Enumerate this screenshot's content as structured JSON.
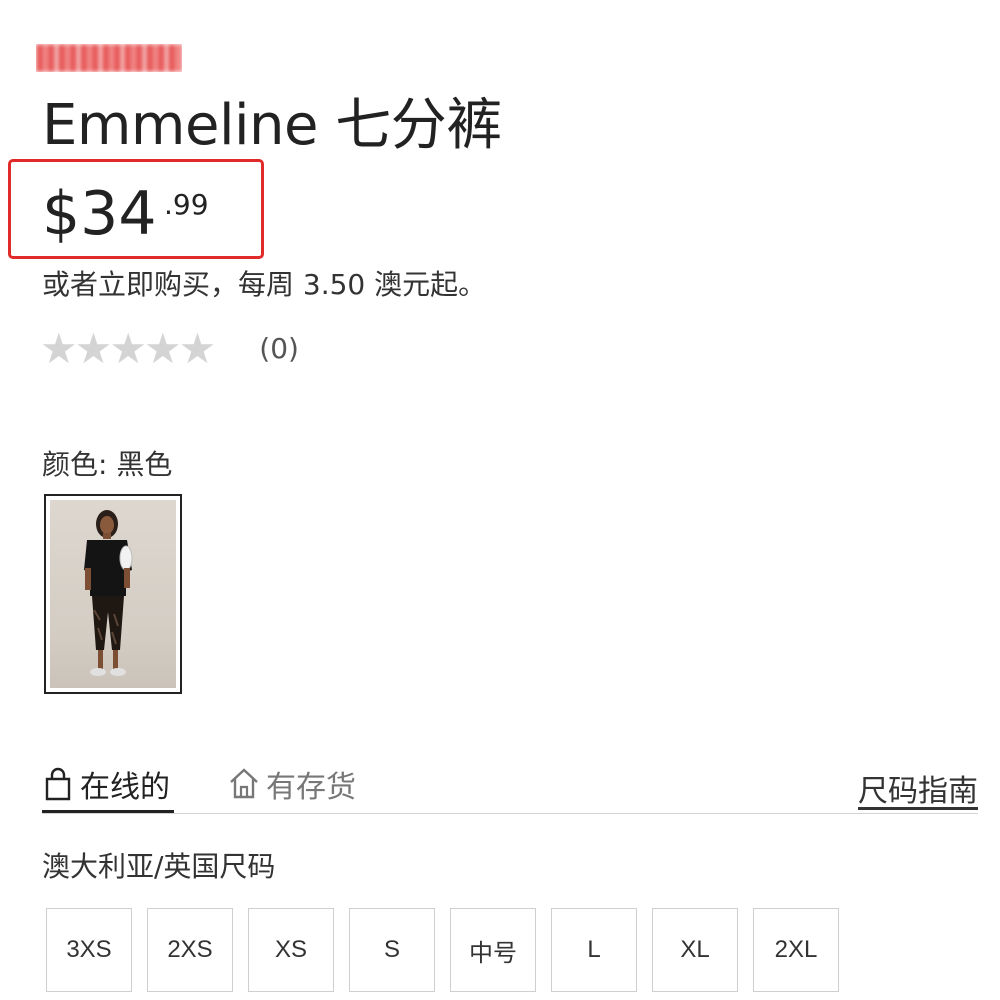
{
  "brand": {
    "logo_text": "COTTON:ON"
  },
  "product": {
    "title": "Emmeline 七分裤",
    "price_main": "$34",
    "price_cents": ".99",
    "installment_text": "或者立即购买，每周 3.50 澳元起。",
    "rating": {
      "stars": 0,
      "max_stars": 5,
      "review_count": "(0)"
    },
    "color_label": "颜色: 黑色"
  },
  "tabs": {
    "online_label": "在线的",
    "instock_label": "有存货",
    "size_guide_label": "尺码指南"
  },
  "sizes": {
    "system_label": "澳大利亚/英国尺码",
    "options": [
      "3XS",
      "2XS",
      "XS",
      "S",
      "中号",
      "L",
      "XL",
      "2XL"
    ]
  },
  "colors": {
    "price_highlight_border": "#e12a2a",
    "star_empty": "#d4d4d4",
    "brand_red": "#e33b3b"
  },
  "icons": {
    "star": "star-icon",
    "online_tab": "shopping-bag-icon",
    "instock_tab": "store-icon"
  }
}
